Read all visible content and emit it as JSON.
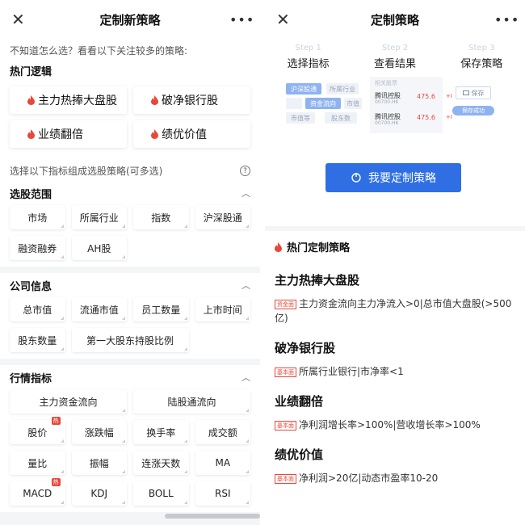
{
  "left": {
    "header": {
      "title": "定制新策略"
    },
    "hint": "不知道怎么选？看看以下关注较多的策略:",
    "hot_section_title": "热门逻辑",
    "hot_items": [
      "主力热捧大盘股",
      "破净银行股",
      "业绩翻倍",
      "绩优价值"
    ],
    "select_intro": "选择以下指标组成选股策略(可多选)",
    "groups": [
      {
        "title": "选股范围",
        "options": [
          "市场",
          "所属行业",
          "指数",
          "沪深股通",
          "融资融券",
          "AH股"
        ]
      },
      {
        "title": "公司信息",
        "options": [
          "总市值",
          "流通市值",
          "员工数量",
          "上市时间",
          "股东数量",
          "第一大股东持股比例"
        ]
      },
      {
        "title": "行情指标",
        "options": [
          "主力资金流向",
          "陆股通流向",
          "股价",
          "涨跌幅",
          "换手率",
          "成交额",
          "量比",
          "振幅",
          "连涨天数",
          "MA",
          "MACD",
          "KDJ",
          "BOLL",
          "RSI"
        ]
      }
    ],
    "badge_text": "热"
  },
  "right": {
    "header": {
      "title": "定制策略"
    },
    "steps": [
      {
        "num": "Step 1",
        "label": "选择指标"
      },
      {
        "num": "Step 2",
        "label": "查看结果"
      },
      {
        "num": "Step 3",
        "label": "保存策略"
      }
    ],
    "preview": {
      "chips": [
        "沪深股通",
        "所属行业",
        "资金流向",
        "市值",
        "市值等",
        "股东数"
      ],
      "result_header": "相关股票",
      "rows": [
        {
          "name": "腾讯控股",
          "code": "00700.HK",
          "price": "475.6",
          "change": "+I"
        },
        {
          "name": "腾讯控股",
          "code": "00700.HK",
          "price": "475.6",
          "change": "+I"
        }
      ],
      "save_label": "保存",
      "save_ok": "保存成功"
    },
    "cta_label": "我要定制策略",
    "hot_title": "热门定制策略",
    "strategies": [
      {
        "title": "主力热捧大盘股",
        "tag": "资金面",
        "desc": "主力资金流向主力净流入>0|总市值大盘股(>500亿)"
      },
      {
        "title": "破净银行股",
        "tag": "基本面",
        "desc": "所属行业银行|市净率<1"
      },
      {
        "title": "业绩翻倍",
        "tag": "基本面",
        "desc": "净利润增长率>100%|营收增长率>100%"
      },
      {
        "title": "绩优价值",
        "tag": "基本面",
        "desc": "净利润>20亿|动态市盈率10-20"
      }
    ]
  },
  "colors": {
    "accent": "#2f6fe3",
    "hot": "#e8483b",
    "price_red": "#e8483b"
  },
  "icons": [
    "close-icon",
    "more-icon",
    "flame-icon",
    "question-icon",
    "chevron-up-icon",
    "power-icon",
    "folder-icon"
  ]
}
